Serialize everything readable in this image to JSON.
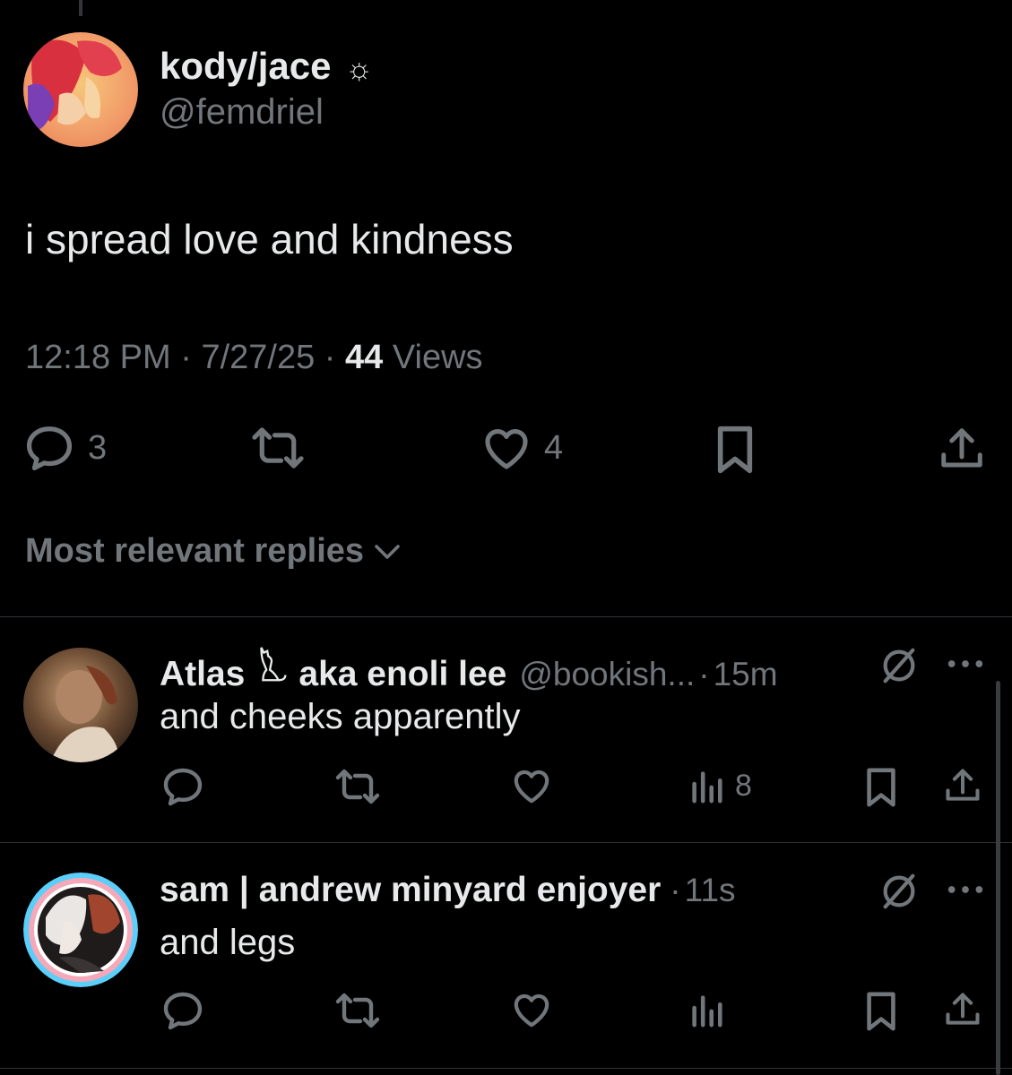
{
  "tweet": {
    "author_name": "kody/jace",
    "author_badge": "☼",
    "author_handle": "@femdriel",
    "text": "i spread love and kindness",
    "time": "12:18 PM",
    "date": "7/27/25",
    "views_count": "44",
    "views_label": "Views",
    "separator": "·",
    "reply_count": "3",
    "like_count": "4"
  },
  "sort": {
    "label": "Most relevant replies"
  },
  "replies": [
    {
      "name_part1": "Atlas",
      "name_emoji": "🐈",
      "name_part2": "aka enoli lee",
      "handle": "@bookish...",
      "separator": "·",
      "time": "15m",
      "text": "and cheeks apparently",
      "views_count": "8"
    },
    {
      "name": "sam | andrew minyard enjoyer",
      "separator": "·",
      "time": "11s",
      "text": "and legs",
      "views_count": ""
    }
  ],
  "colors": {
    "background": "#000000",
    "text_primary": "#e7e9ea",
    "text_secondary": "#71767b",
    "divider": "#2f3336"
  }
}
